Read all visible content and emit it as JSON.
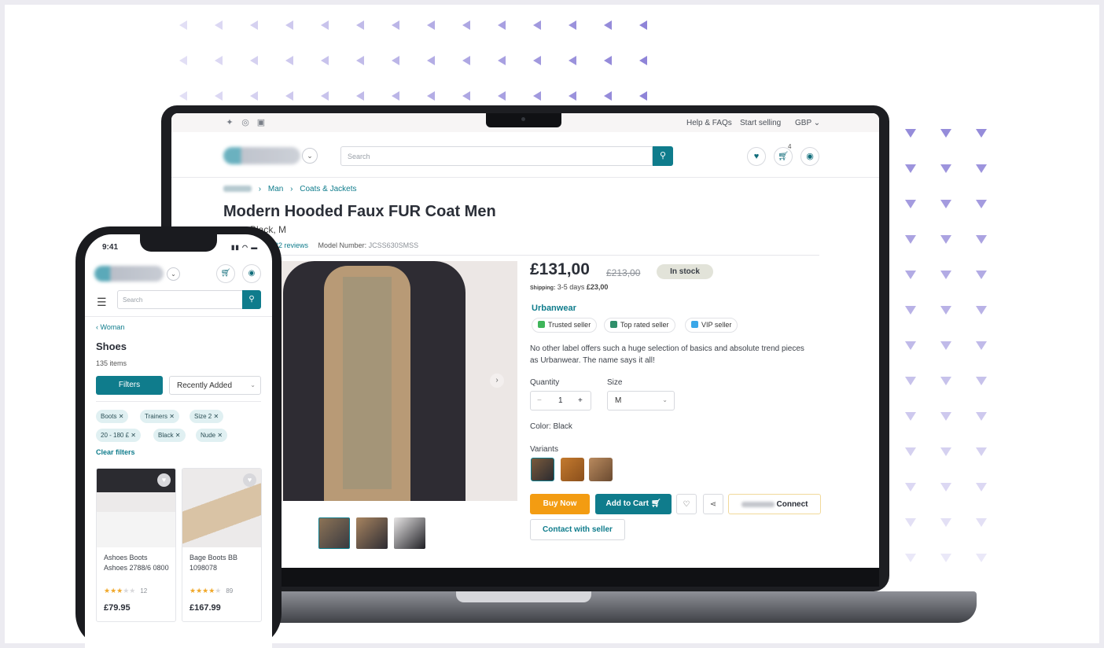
{
  "laptop": {
    "topbar": {
      "social": [
        "twitter-icon",
        "instagram-icon",
        "facebook-icon"
      ],
      "links": [
        "Help & FAQs",
        "Start selling",
        "GBP"
      ]
    },
    "search": {
      "placeholder": "Search"
    },
    "cart_count": "4",
    "breadcrumb": [
      "Man",
      "Coats & Jackets"
    ],
    "product": {
      "title": "Modern Hooded Faux FUR Coat Men",
      "subtitle": "Black, M",
      "reviews": "132 reviews",
      "model_label": "Model Number:",
      "model_number": "JCSS630SMSS",
      "price": "£131,00",
      "old_price": "£213,00",
      "stock": "In stock",
      "shipping_label": "Shipping:",
      "shipping_days": "3-5 days",
      "shipping_price": "£23,00",
      "seller": "Urbanwear",
      "badges": [
        "Trusted seller",
        "Top rated seller",
        "VIP seller"
      ],
      "description": "No other label offers such a huge selection of basics and absolute trend pieces as Urbanwear. The name says it all!",
      "quantity_label": "Quantity",
      "quantity": "1",
      "size_label": "Size",
      "size": "M",
      "color": "Color: Black",
      "variants_label": "Variants",
      "buy_now": "Buy Now",
      "add_to_cart": "Add to Cart",
      "connect": "Connect",
      "contact": "Contact with seller"
    }
  },
  "phone": {
    "time": "9:41",
    "search": {
      "placeholder": "Search"
    },
    "back": "Woman",
    "heading": "Shoes",
    "count": "135 items",
    "filters": "Filters",
    "sort": "Recently Added",
    "chips": [
      "Boots",
      "Trainers",
      "Size 2",
      "20 - 180 £",
      "Black",
      "Nude"
    ],
    "clear": "Clear filters",
    "products": [
      {
        "name": "Ashoes Boots Ashoes 2788/6 0800",
        "rating": 3,
        "reviews": "12",
        "price": "£79.95"
      },
      {
        "name": "Bage Boots BB 1098078",
        "rating": 4,
        "reviews": "89",
        "price": "£167.99"
      }
    ]
  },
  "colors": {
    "accent": "#0f7c8c",
    "buy": "#f39c12",
    "decor": "#8a7fd6"
  }
}
